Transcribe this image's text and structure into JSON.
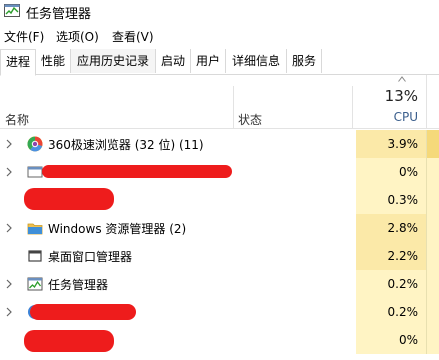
{
  "window": {
    "title": "任务管理器"
  },
  "menu": [
    {
      "label": "文件(F)"
    },
    {
      "label": "选项(O)"
    },
    {
      "label": "查看(V)"
    }
  ],
  "tabs": [
    {
      "label": "进程",
      "active": true
    },
    {
      "label": "性能"
    },
    {
      "label": "应用历史记录"
    },
    {
      "label": "启动"
    },
    {
      "label": "用户"
    },
    {
      "label": "详细信息"
    },
    {
      "label": "服务"
    }
  ],
  "columns": {
    "name": "名称",
    "status": "状态",
    "cpu_total": "13%",
    "cpu": "CPU"
  },
  "processes": [
    {
      "name": "360极速浏览器 (32 位) (11)",
      "cpu": "3.9%",
      "icon": "360-browser-icon",
      "expandable": true
    },
    {
      "name": "",
      "cpu": "0%",
      "icon": "window-icon",
      "expandable": true,
      "redacted": true
    },
    {
      "name": "",
      "cpu": "0.3%",
      "icon": "",
      "expandable": false,
      "redacted": true
    },
    {
      "name": "Windows 资源管理器 (2)",
      "cpu": "2.8%",
      "icon": "folder-icon",
      "expandable": true
    },
    {
      "name": "桌面窗口管理器",
      "cpu": "2.2%",
      "icon": "desktop-window-icon",
      "expandable": false
    },
    {
      "name": "任务管理器",
      "cpu": "0.2%",
      "icon": "task-manager-icon",
      "expandable": true
    },
    {
      "name": "",
      "cpu": "0.2%",
      "icon": "globe-icon",
      "expandable": true,
      "redacted": true
    },
    {
      "name": "",
      "cpu": "0%",
      "icon": "",
      "expandable": false,
      "redacted": true
    }
  ],
  "colors": {
    "cpu_cell": "#fff4c4",
    "cpu_cell_high": "#fbe9a8",
    "accent_text": "#3a5e8c",
    "redaction": "#ee1c1c"
  }
}
